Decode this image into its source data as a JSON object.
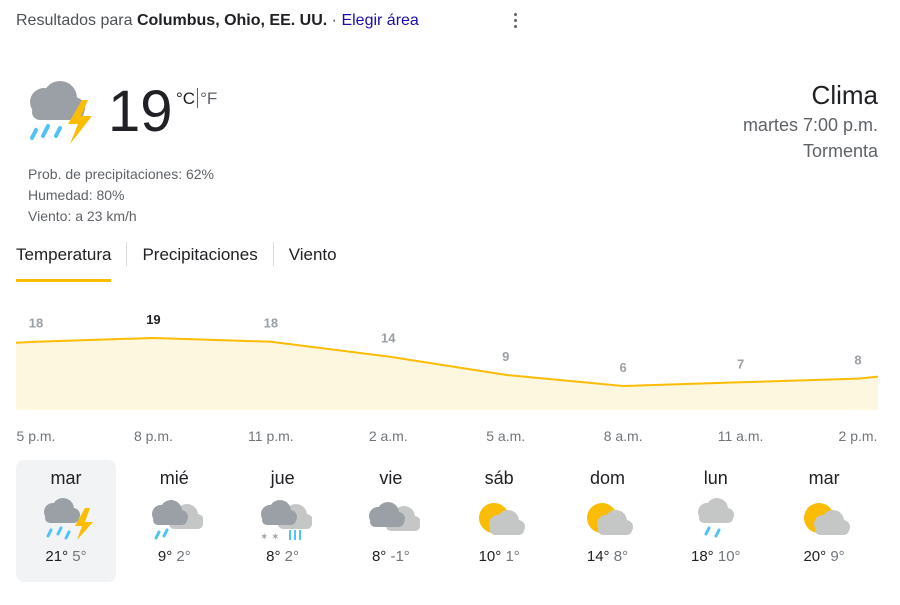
{
  "header": {
    "prefix": "Resultados para",
    "location": "Columbus, Ohio, EE. UU.",
    "separator": "·",
    "choose_area": "Elegir área",
    "more_icon": "vertical-dots-icon"
  },
  "current": {
    "icon": "thunderstorm-icon",
    "temperature": "19",
    "unit_c": "°C",
    "unit_f": "°F",
    "precip": "Prob. de precipitaciones: 62%",
    "humidity": "Humedad: 80%",
    "wind": "Viento: a 23 km/h"
  },
  "summary": {
    "title": "Clima",
    "time": "martes 7:00 p.m.",
    "condition": "Tormenta"
  },
  "tabs": {
    "temperature": "Temperatura",
    "precipitation": "Precipitaciones",
    "wind": "Viento",
    "active": "temperature"
  },
  "chart_data": {
    "type": "area",
    "color_line": "#fbbc04",
    "color_fill": "#fef7e0",
    "hour_labels": [
      "5 p.m.",
      "8 p.m.",
      "11 p.m.",
      "2 a.m.",
      "5 a.m.",
      "8 a.m.",
      "11 a.m.",
      "2 p.m."
    ],
    "values": [
      18,
      19,
      18,
      14,
      9,
      6,
      7,
      8
    ],
    "value_labels": [
      "18",
      "19",
      "18",
      "14",
      "9",
      "6",
      "7",
      "8"
    ],
    "highlight_index": 1
  },
  "days": [
    {
      "name": "mar",
      "icon": "thunderstorm-icon",
      "high": "21°",
      "low": "5°"
    },
    {
      "name": "mié",
      "icon": "rain-and-clouds-icon",
      "high": "9°",
      "low": "2°"
    },
    {
      "name": "jue",
      "icon": "snow-and-rain-icon",
      "high": "8°",
      "low": "2°"
    },
    {
      "name": "vie",
      "icon": "cloudy-icon",
      "high": "8°",
      "low": "-1°"
    },
    {
      "name": "sáb",
      "icon": "partly-cloudy-icon",
      "high": "10°",
      "low": "1°"
    },
    {
      "name": "dom",
      "icon": "partly-cloudy-icon",
      "high": "14°",
      "low": "8°"
    },
    {
      "name": "lun",
      "icon": "rain-icon",
      "high": "18°",
      "low": "10°"
    },
    {
      "name": "mar",
      "icon": "partly-cloudy-icon",
      "high": "20°",
      "low": "9°"
    }
  ]
}
